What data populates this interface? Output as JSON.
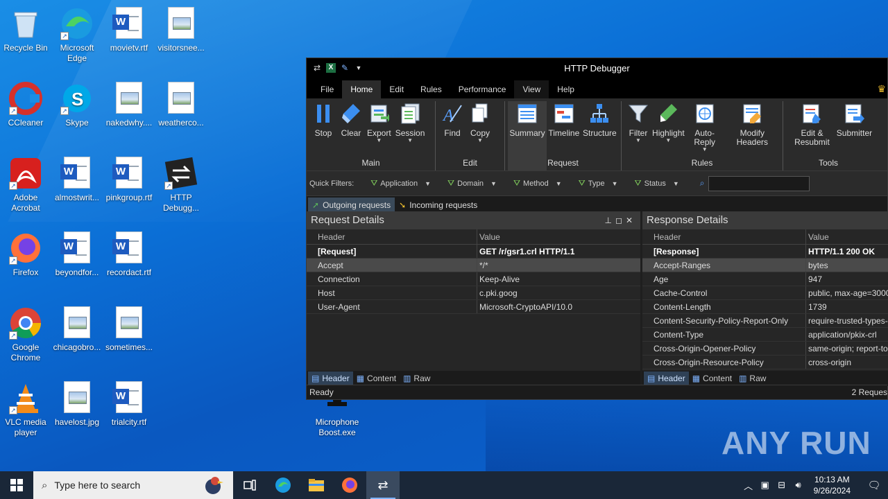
{
  "desktop": {
    "icons": [
      {
        "label": "Recycle Bin",
        "kind": "recycle-bin"
      },
      {
        "label": "Microsoft Edge",
        "kind": "edge"
      },
      {
        "label": "movietv.rtf",
        "kind": "word-doc"
      },
      {
        "label": "visitorsnee...",
        "kind": "image-file"
      },
      {
        "label": "CCleaner",
        "kind": "ccleaner"
      },
      {
        "label": "Skype",
        "kind": "skype"
      },
      {
        "label": "nakedwhy....",
        "kind": "image-file"
      },
      {
        "label": "weatherco...",
        "kind": "image-file"
      },
      {
        "label": "Adobe Acrobat",
        "kind": "acrobat"
      },
      {
        "label": "almostwrit...",
        "kind": "word-doc"
      },
      {
        "label": "pinkgroup.rtf",
        "kind": "word-doc"
      },
      {
        "label": "HTTP Debugg...",
        "kind": "http-debugger"
      },
      {
        "label": "Firefox",
        "kind": "firefox"
      },
      {
        "label": "beyondfor...",
        "kind": "word-doc"
      },
      {
        "label": "recordact.rtf",
        "kind": "word-doc"
      },
      {
        "label": "Google Chrome",
        "kind": "chrome"
      },
      {
        "label": "chicagobro...",
        "kind": "image-file"
      },
      {
        "label": "sometimes...",
        "kind": "image-file"
      },
      {
        "label": "VLC media player",
        "kind": "vlc"
      },
      {
        "label": "havelost.jpg",
        "kind": "image-file"
      },
      {
        "label": "trialcity.rtf",
        "kind": "word-doc"
      },
      {
        "label": "Microphone Boost.exe",
        "kind": "exe"
      }
    ]
  },
  "window": {
    "title": "HTTP Debugger",
    "menu": [
      "File",
      "Home",
      "Edit",
      "Rules",
      "Performance",
      "View",
      "Help"
    ],
    "active_menu": "Home",
    "ribbon": {
      "groups": [
        {
          "label": "Main",
          "buttons": [
            "Stop",
            "Clear",
            "Export",
            "Session"
          ]
        },
        {
          "label": "Edit",
          "buttons": [
            "Find",
            "Copy"
          ]
        },
        {
          "label": "Request",
          "buttons": [
            "Summary",
            "Timeline",
            "Structure"
          ]
        },
        {
          "label": "Rules",
          "buttons": [
            "Filter",
            "Highlight",
            "Auto-Reply",
            "Modify Headers"
          ]
        },
        {
          "label": "Tools",
          "buttons": [
            "Edit & Resubmit",
            "Submitter"
          ]
        }
      ]
    },
    "quick_filters": {
      "label": "Quick Filters:",
      "items": [
        "Application",
        "Domain",
        "Method",
        "Type",
        "Status"
      ],
      "search_value": ""
    },
    "request_tabs": [
      "Outgoing requests",
      "Incoming requests"
    ],
    "request_pane": {
      "title": "Request Details",
      "col_header": "Header",
      "col_value": "Value",
      "rows": [
        {
          "h": "[Request]",
          "v": "GET /r/gsr1.crl HTTP/1.1"
        },
        {
          "h": "Accept",
          "v": "*/*"
        },
        {
          "h": "Connection",
          "v": "Keep-Alive"
        },
        {
          "h": "Host",
          "v": "c.pki.goog"
        },
        {
          "h": "User-Agent",
          "v": "Microsoft-CryptoAPI/10.0"
        }
      ],
      "tabs": [
        "Header",
        "Content",
        "Raw"
      ]
    },
    "response_pane": {
      "title": "Response Details",
      "col_header": "Header",
      "col_value": "Value",
      "rows": [
        {
          "h": "[Response]",
          "v": "HTTP/1.1 200 OK"
        },
        {
          "h": "Accept-Ranges",
          "v": "bytes"
        },
        {
          "h": "Age",
          "v": "947"
        },
        {
          "h": "Cache-Control",
          "v": "public, max-age=3000"
        },
        {
          "h": "Content-Length",
          "v": "1739"
        },
        {
          "h": "Content-Security-Policy-Report-Only",
          "v": "require-trusted-types-"
        },
        {
          "h": "Content-Type",
          "v": "application/pkix-crl"
        },
        {
          "h": "Cross-Origin-Opener-Policy",
          "v": "same-origin; report-to"
        },
        {
          "h": "Cross-Origin-Resource-Policy",
          "v": "cross-origin"
        }
      ],
      "tabs": [
        "Header",
        "Content",
        "Raw"
      ]
    },
    "status": {
      "left": "Ready",
      "right": "2 Reques"
    }
  },
  "watermark": "ANY RUN",
  "taskbar": {
    "search_placeholder": "Type here to search",
    "time": "10:13 AM",
    "date": "9/26/2024"
  },
  "colors": {
    "wallpaper": "#0b6fd6",
    "window_bg": "#1f1f1f",
    "accent": "#7fb4ff"
  }
}
